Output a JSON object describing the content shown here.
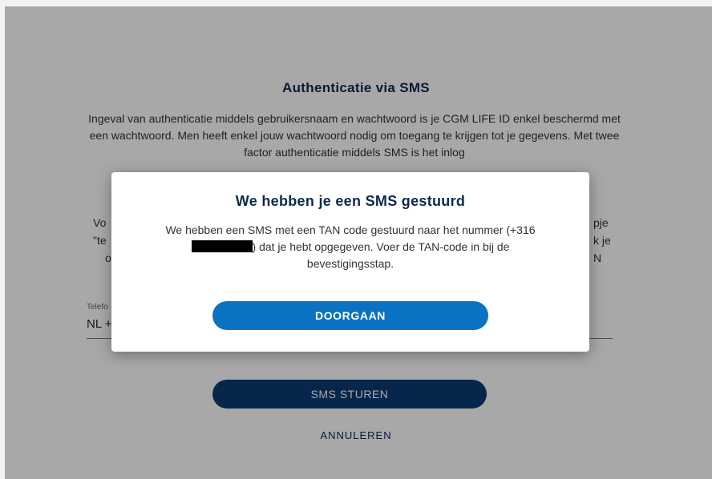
{
  "page": {
    "title": "Authenticatie via SMS",
    "intro": "Ingeval van authenticatie middels gebruikersnaam en wachtwoord is je CGM LIFE ID enkel beschermd met een wachtwoord. Men heeft enkel jouw wachtwoord nodig om toegang te krijgen tot je gegevens. Met twee factor authenticatie middels SMS is het inlog",
    "note_fragments": [
      "Vo",
      "\"te",
      "o",
      "pje",
      "k je",
      "N"
    ],
    "phone_label": "Telefo",
    "phone_value": "NL +",
    "send_button": "SMS STUREN",
    "cancel_link": "ANNULEREN"
  },
  "modal": {
    "title": "We hebben je een SMS gestuurd",
    "body_before": "We hebben een SMS met een TAN code gestuurd naar het nummer (+316",
    "body_after": ") dat je hebt opgegeven. Voer de TAN-code in bij de bevestigingsstap.",
    "continue_button": "DOORGAAN"
  }
}
